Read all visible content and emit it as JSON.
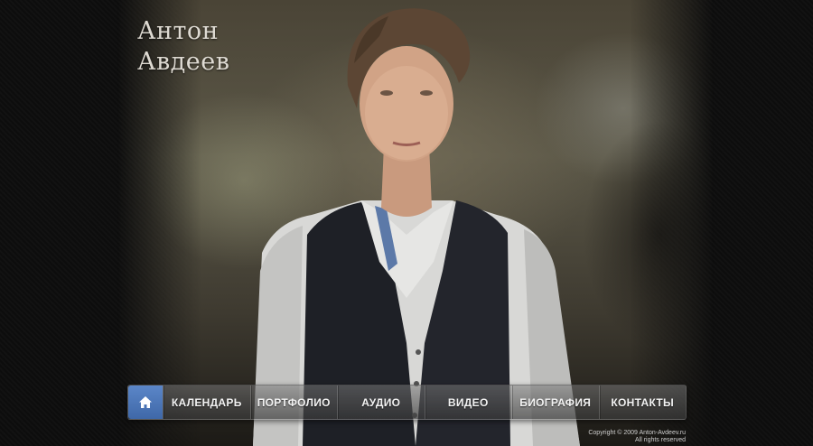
{
  "header": {
    "title_line1": "Антон",
    "title_line2": "Авдеев"
  },
  "photo": {
    "subject": "portrait-of-man-in-vest"
  },
  "nav": {
    "home_icon": "home-icon",
    "items": [
      {
        "label": "КАЛЕНДАРЬ"
      },
      {
        "label": "ПОРТФОЛИО"
      },
      {
        "label": "АУДИО"
      },
      {
        "label": "ВИДЕО"
      },
      {
        "label": "БИОГРАФИЯ"
      },
      {
        "label": "КОНТАКТЫ"
      }
    ],
    "active_color": "#4a75b8"
  },
  "footer": {
    "copyright_line1": "Copyright © 2009 Anton-Avdeev.ru",
    "copyright_line2": "All rights reserved"
  }
}
